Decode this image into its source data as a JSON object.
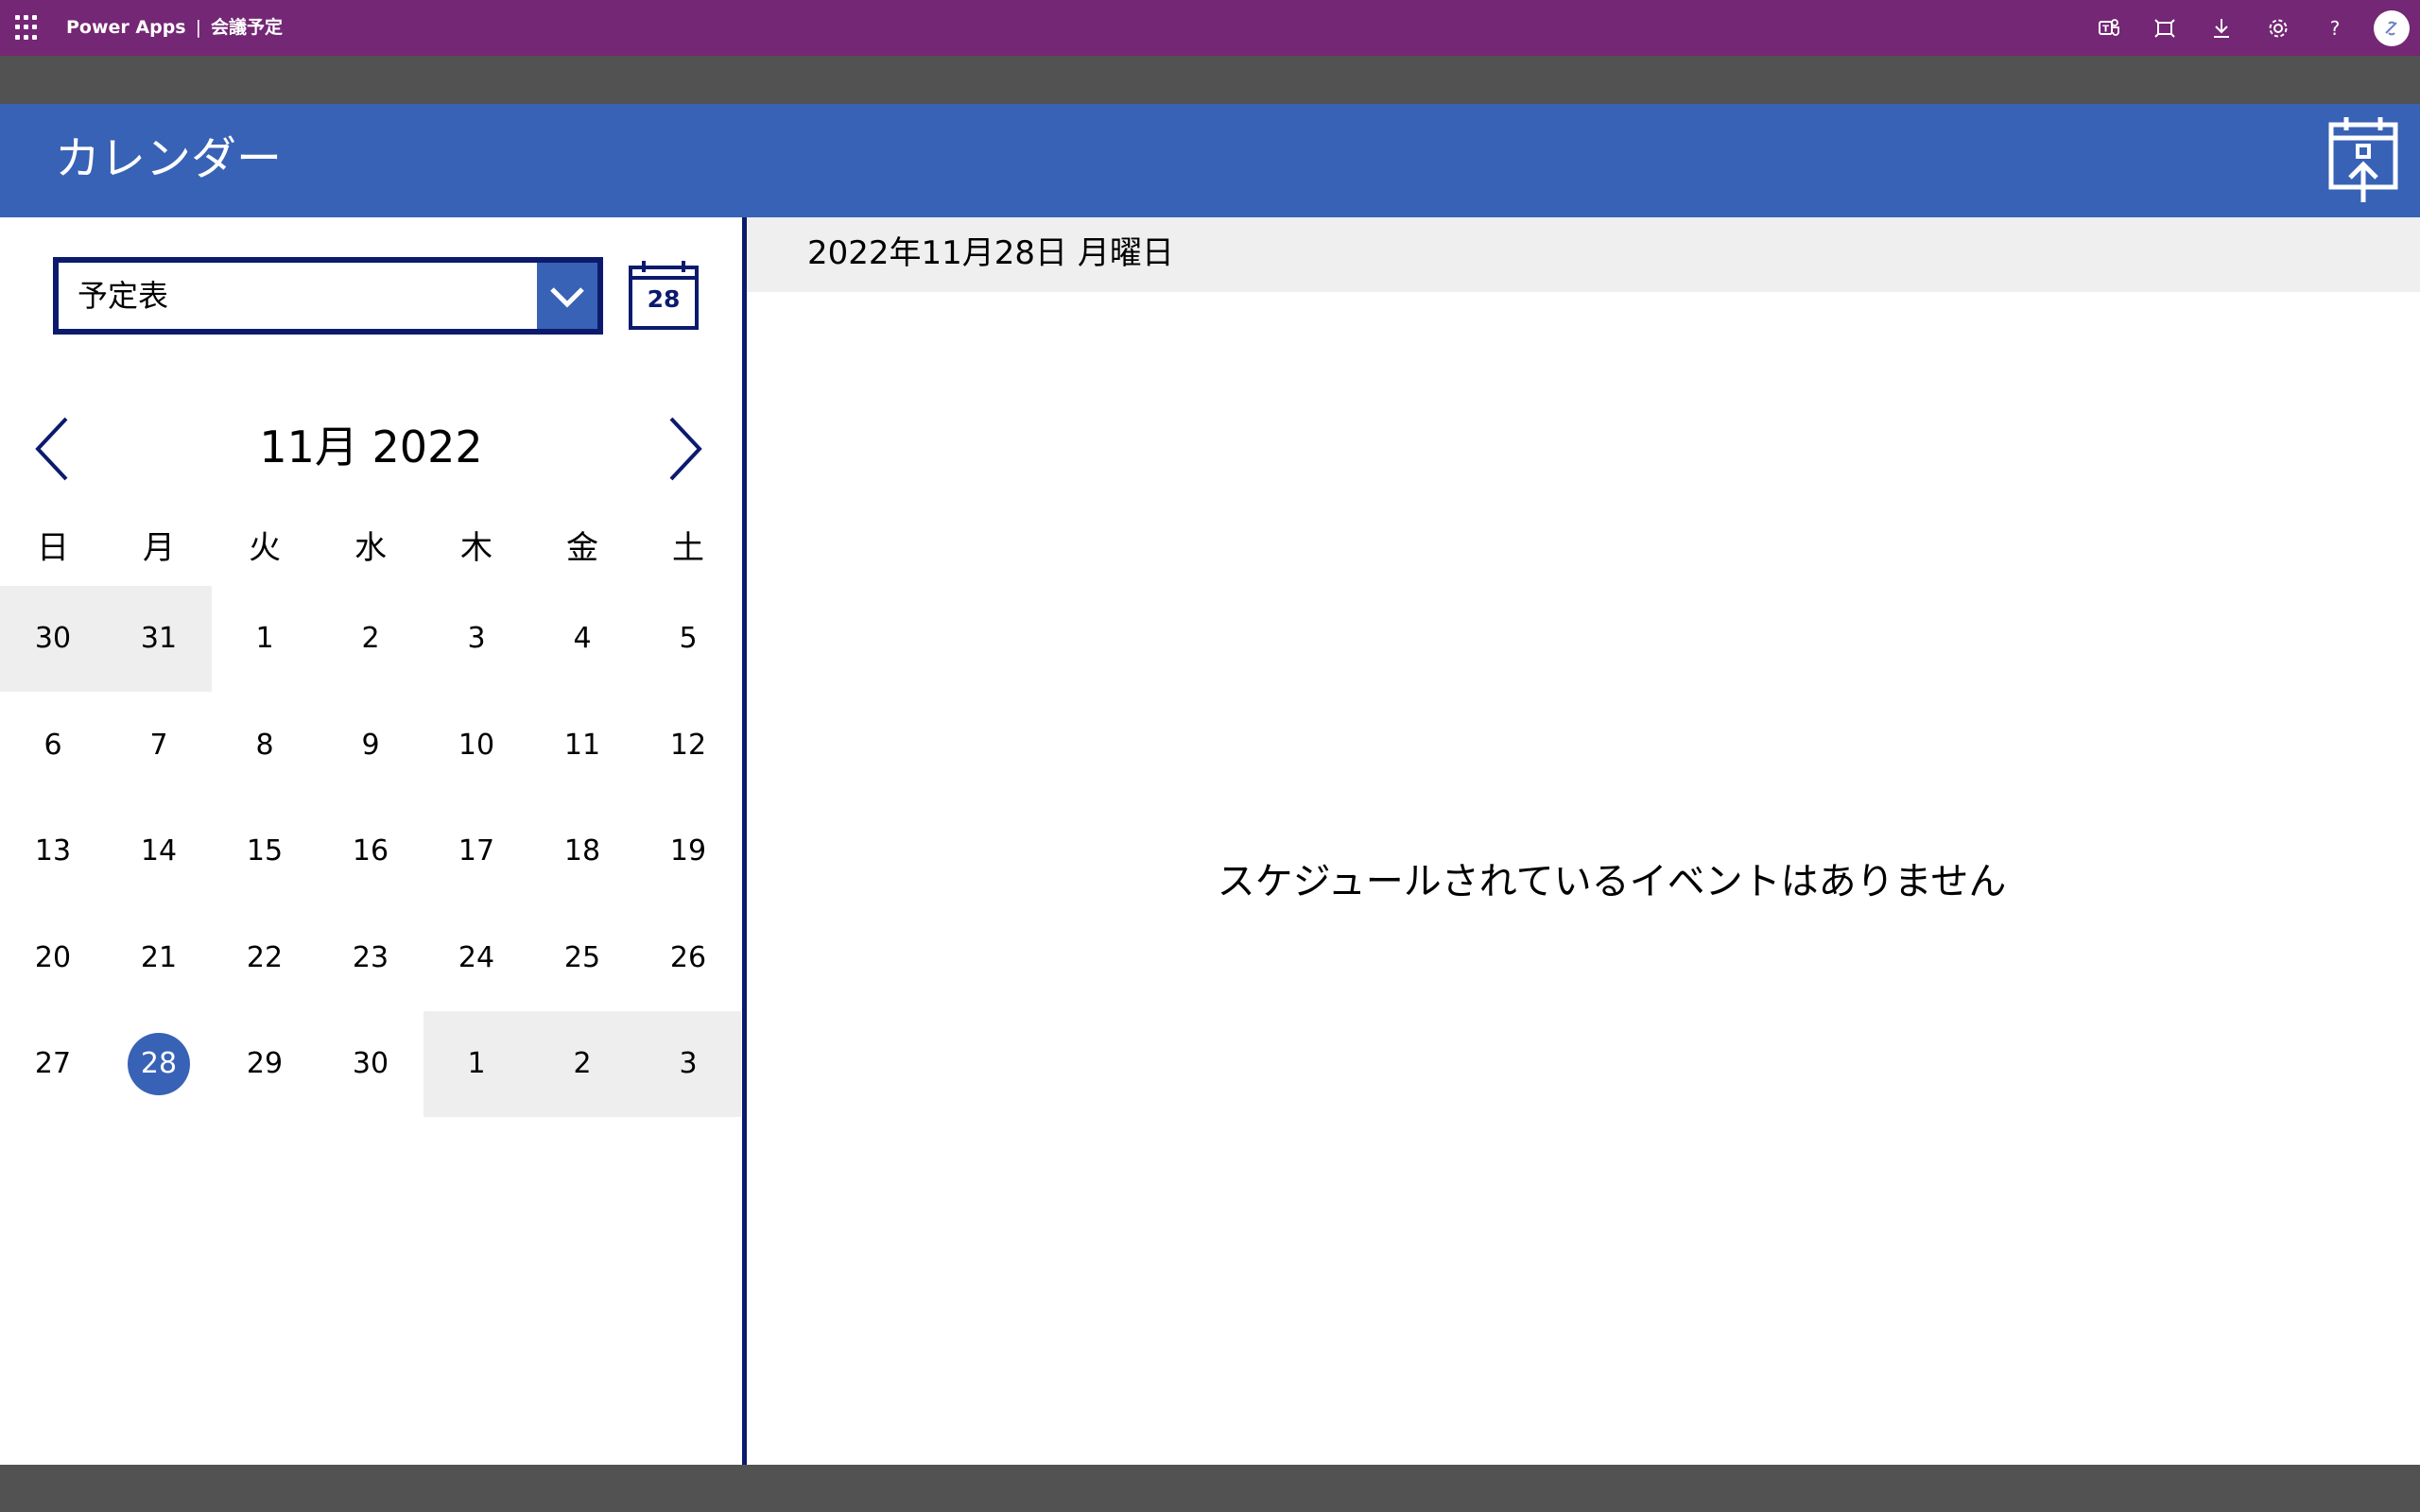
{
  "topbar": {
    "brand": "Power Apps",
    "separator": "|",
    "app_name": "会議予定",
    "icons": [
      "teams-icon",
      "fit-to-window-icon",
      "download-icon",
      "settings-icon",
      "help-icon",
      "avatar"
    ],
    "help_glyph": "?",
    "colors": {
      "background": "#742774",
      "text": "#FFFFFF"
    }
  },
  "header": {
    "title": "カレンダー",
    "export_icon": "calendar-export-icon",
    "colors": {
      "background": "#3862B6"
    }
  },
  "calendar_select": {
    "value": "予定表"
  },
  "today_button": {
    "day": "28"
  },
  "month_nav": {
    "label": "11月 2022",
    "prev_icon": "chevron-left-icon",
    "next_icon": "chevron-right-icon"
  },
  "weekdays": [
    "日",
    "月",
    "火",
    "水",
    "木",
    "金",
    "土"
  ],
  "weeks": [
    [
      {
        "d": "30",
        "other": true
      },
      {
        "d": "31",
        "other": true
      },
      {
        "d": "1"
      },
      {
        "d": "2"
      },
      {
        "d": "3"
      },
      {
        "d": "4"
      },
      {
        "d": "5"
      }
    ],
    [
      {
        "d": "6"
      },
      {
        "d": "7"
      },
      {
        "d": "8"
      },
      {
        "d": "9"
      },
      {
        "d": "10"
      },
      {
        "d": "11"
      },
      {
        "d": "12"
      }
    ],
    [
      {
        "d": "13"
      },
      {
        "d": "14"
      },
      {
        "d": "15"
      },
      {
        "d": "16"
      },
      {
        "d": "17"
      },
      {
        "d": "18"
      },
      {
        "d": "19"
      }
    ],
    [
      {
        "d": "20"
      },
      {
        "d": "21"
      },
      {
        "d": "22"
      },
      {
        "d": "23"
      },
      {
        "d": "24"
      },
      {
        "d": "25"
      },
      {
        "d": "26"
      }
    ],
    [
      {
        "d": "27"
      },
      {
        "d": "28",
        "selected": true
      },
      {
        "d": "29"
      },
      {
        "d": "30"
      },
      {
        "d": "1",
        "other": true
      },
      {
        "d": "2",
        "other": true
      },
      {
        "d": "3",
        "other": true
      }
    ]
  ],
  "selected_date_label": "2022年11月28日 月曜日",
  "empty_message": "スケジュールされているイベントはありません",
  "colors": {
    "accent": "#3862B6",
    "dark_navy": "#0C1A6E",
    "outside_month": "#EEEEEE",
    "date_bar": "#EFEFEF"
  }
}
